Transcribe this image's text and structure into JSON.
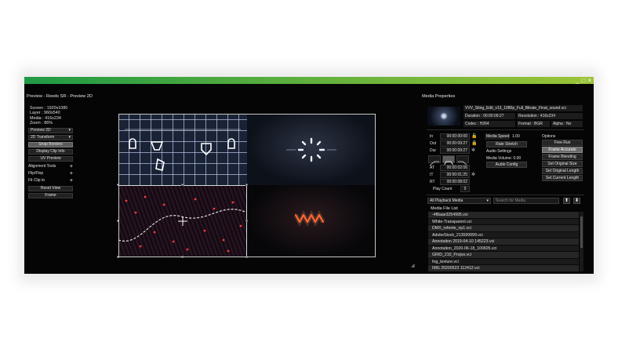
{
  "window": {
    "controls": [
      "_",
      "□",
      "×"
    ]
  },
  "preview": {
    "header": "Preview - Reeds SR - Preview 2D",
    "info": [
      "Screen : 1920x1080",
      "Layer : 960x540",
      "Media : 416x234",
      "Zoom : 86%"
    ],
    "view_mode": "Preview 2D",
    "transform_mode": "2D Transform",
    "buttons": {
      "snap": "Snap Borders",
      "clip_info": "Display Clip Info",
      "uv": "UV Preview",
      "reset": "Reset View",
      "frame": "Frame"
    },
    "tools": [
      "Alignment Tools",
      "Flip/Flop",
      "Fit Clip to"
    ]
  },
  "media_properties": {
    "header": "Media Properties",
    "file_name": "VVV_Sting_Edit_v13_1080p_Full_Bitrate_Final_sound.vci",
    "duration": "Duration : 00:00:09:27",
    "resolution": "Resolution : 416x234",
    "codec": "Codec : H264",
    "format": "Format : BGR",
    "alpha": "Alpha : No",
    "timecodes": [
      {
        "label": "In",
        "value": "00:00:00:00"
      },
      {
        "label": "Out",
        "value": "00:00:09:27"
      },
      {
        "label": "Dur",
        "value": "00:00:09:27"
      }
    ],
    "times": [
      {
        "label": "AT",
        "value": "00:00:02:06"
      },
      {
        "label": "IT",
        "value": "00:00:01:25"
      },
      {
        "label": "RT",
        "value": "00:00:08:02"
      }
    ],
    "play_count_label": "Play Count",
    "play_count": "0",
    "media_speed_label": "Media Speed",
    "media_speed": "1.00",
    "rate_stretch": "Rate Stretch",
    "audio_settings": "Audio Settings",
    "media_volume": "Media Volume: 0.00",
    "audio_config": "Audio Config",
    "options_label": "Options",
    "options": [
      "Free Run",
      "Frame Accurate",
      "Frame Blending",
      "Set Original Size",
      "Set Original Length",
      "Set Current Length"
    ],
    "active_option": "Frame Accurate"
  },
  "media_list": {
    "filter": "All Playback Media",
    "search_placeholder": "Search for Media",
    "title": "Media File List",
    "files": [
      "-4f8aae3254995.vci",
      "White-Transparent.vci",
      "DMX_refente_np1.vci",
      "AdobeStock_213599999.vci",
      "Annotation 2019-04-10 145223.vci",
      "Annotation_2020-06-18_100605.vci",
      "GRID_210_Projos.vci",
      "fog_texture.vci",
      "IMG 20200523 112412.vci"
    ]
  },
  "colors": {
    "accent_green": "#66b23c",
    "panel_bg": "#050505"
  }
}
